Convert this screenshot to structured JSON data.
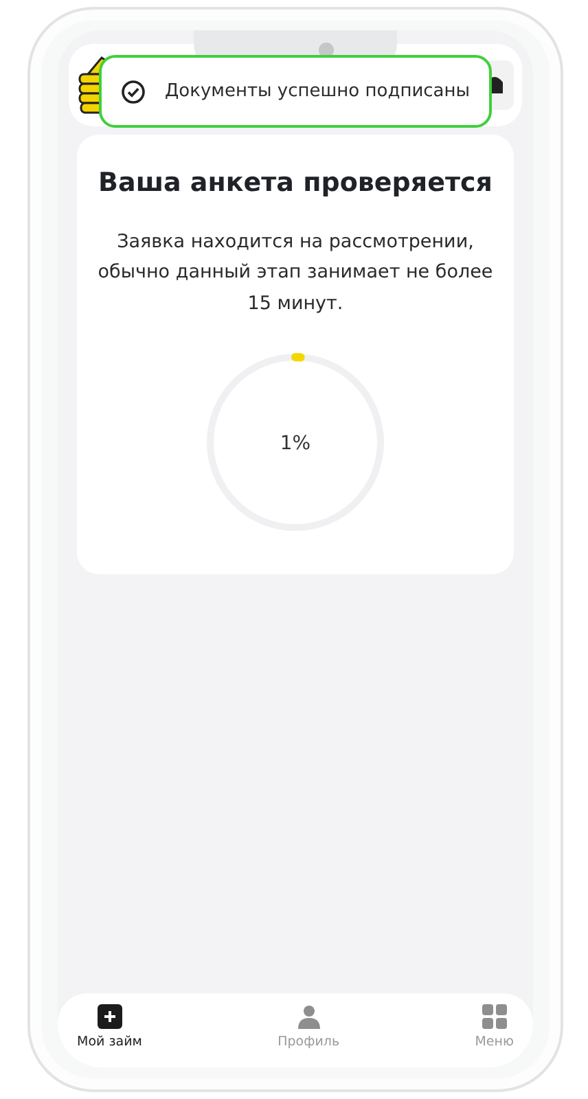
{
  "toast": {
    "text": "Документы успешно подписаны"
  },
  "card": {
    "title": "Ваша анкета проверяется",
    "description": "Заявка находится на рассмотрении, обычно данный этап занимает не более 15 минут.",
    "progress": {
      "level": 0.01,
      "reading": "1%"
    }
  },
  "bottom_nav": [
    {
      "label": "Мой займ",
      "kind": "plus",
      "selected": true
    },
    {
      "label": "Профиль",
      "kind": "person",
      "selected": false
    },
    {
      "label": "Меню",
      "kind": "grid",
      "selected": false
    }
  ]
}
